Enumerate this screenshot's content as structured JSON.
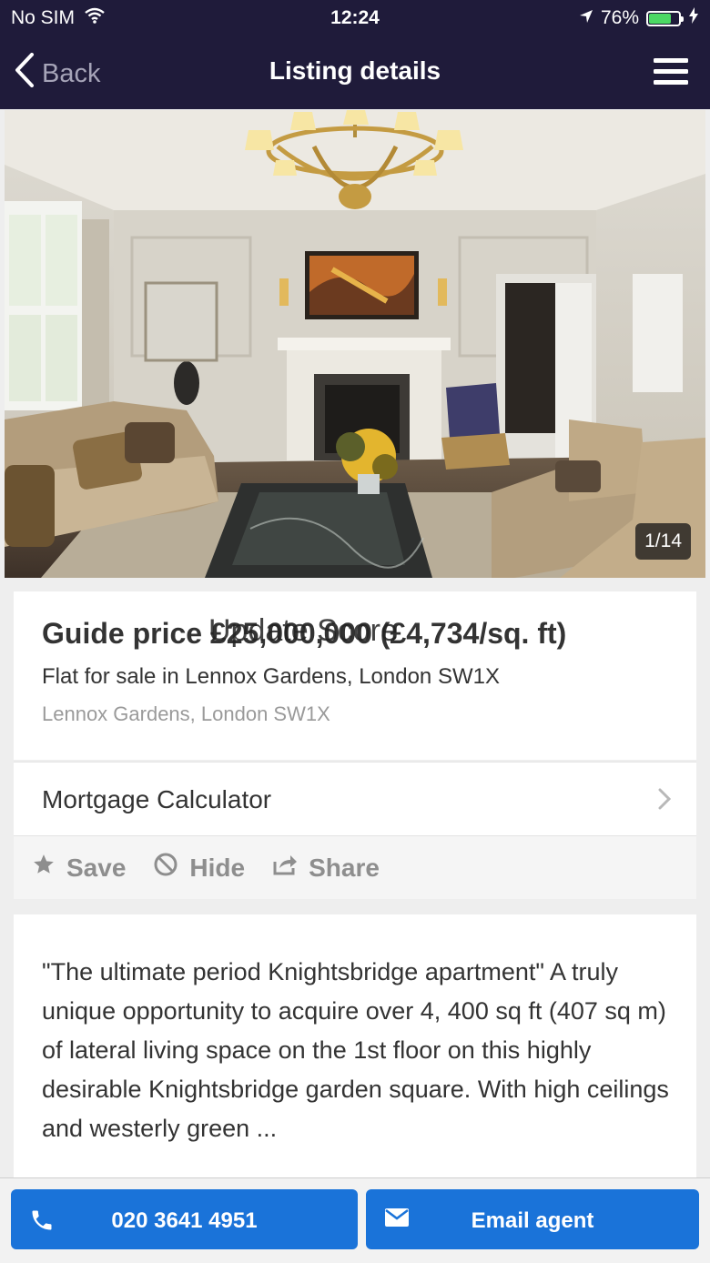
{
  "status_bar": {
    "carrier": "No SIM",
    "time": "12:24",
    "battery": "76%",
    "battery_level": 0.76
  },
  "nav": {
    "back_label": "Back",
    "title": "Listing details"
  },
  "gallery": {
    "counter": "1/14"
  },
  "listing": {
    "price": "Guide price £25,000,000 (£4,734/sq. ft)",
    "price_overlay": "Update Score",
    "subtitle": "Flat for sale in Lennox Gardens, London SW1X",
    "address": "Lennox Gardens, London SW1X"
  },
  "mortgage": {
    "label": "Mortgage Calculator"
  },
  "actions": {
    "save": "Save",
    "hide": "Hide",
    "share": "Share"
  },
  "description": "\"The ultimate period Knightsbridge apartment\" A truly unique opportunity to acquire over 4, 400 sq ft (407 sq m) of lateral living space on the 1st floor on this highly desirable Knightsbridge garden square. With high ceilings and westerly green ...",
  "contact": {
    "phone": "020 3641 4951",
    "email_label": "Email agent"
  },
  "colors": {
    "nav_bg": "#1f1b3a",
    "accent": "#1a73d9",
    "battery": "#4cd964"
  },
  "icons": {
    "wifi": "wifi-icon",
    "location": "location-arrow-icon",
    "charging": "bolt-icon",
    "back": "chevron-left-icon",
    "menu": "hamburger-icon",
    "chevron": "chevron-right-icon",
    "save": "star-icon",
    "hide": "prohibited-icon",
    "share": "share-icon",
    "phone": "phone-icon",
    "email": "envelope-icon"
  }
}
